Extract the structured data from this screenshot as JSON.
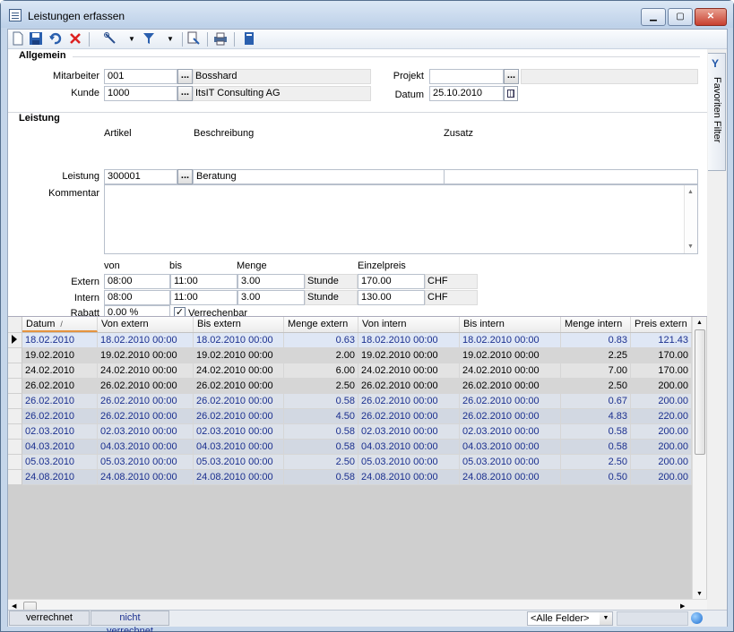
{
  "window": {
    "title": "Leistungen erfassen",
    "min_label": "▁",
    "max_label": "▢",
    "close_label": "✕"
  },
  "toolbar": {
    "icons": [
      "new-document-icon",
      "save-icon",
      "undo-icon",
      "delete-icon",
      "tools-icon",
      "filter-icon",
      "copy-record-icon",
      "print-icon",
      "book-icon"
    ]
  },
  "side_panel": {
    "label": "Favoriten Filter"
  },
  "allgemein": {
    "section_title": "Allgemein",
    "mitarbeiter_label": "Mitarbeiter",
    "mitarbeiter_value": "001",
    "mitarbeiter_name": "Bosshard",
    "kunde_label": "Kunde",
    "kunde_value": "1000",
    "kunde_name": "ItsIT Consulting AG",
    "projekt_label": "Projekt",
    "projekt_value": "",
    "datum_label": "Datum",
    "datum_value": "25.10.2010",
    "dots_label": "..."
  },
  "leistung": {
    "section_title": "Leistung",
    "col_artikel": "Artikel",
    "col_beschreibung": "Beschreibung",
    "col_zusatz": "Zusatz",
    "leistung_label": "Leistung",
    "artikel_value": "300001",
    "beschreibung_value": "Beratung",
    "zusatz_value": "",
    "kommentar_label": "Kommentar",
    "kommentar_value": "",
    "col_von": "von",
    "col_bis": "bis",
    "col_menge": "Menge",
    "col_einzelpreis": "Einzelpreis",
    "extern_label": "Extern",
    "extern_von": "08:00",
    "extern_bis": "11:00",
    "extern_menge": "3.00",
    "extern_einheit": "Stunde",
    "extern_preis": "170.00",
    "extern_waehrung": "CHF",
    "intern_label": "Intern",
    "intern_von": "08:00",
    "intern_bis": "11:00",
    "intern_menge": "3.00",
    "intern_einheit": "Stunde",
    "intern_preis": "130.00",
    "intern_waehrung": "CHF",
    "rabatt_label": "Rabatt",
    "rabatt_value": "0.00 %",
    "verrechenbar_label": "Verrechenbar",
    "verrechenbar_checked": true
  },
  "grid": {
    "columns": [
      "Datum",
      "Von extern",
      "Bis extern",
      "Menge extern",
      "Von intern",
      "Bis intern",
      "Menge intern",
      "Preis extern"
    ],
    "sort_indicator": "/",
    "rows": [
      [
        "18.02.2010",
        "18.02.2010  00:00",
        "18.02.2010  00:00",
        "0.63",
        "18.02.2010  00:00",
        "18.02.2010  00:00",
        "0.83",
        "121.43"
      ],
      [
        "19.02.2010",
        "19.02.2010  00:00",
        "19.02.2010  00:00",
        "2.00",
        "19.02.2010  00:00",
        "19.02.2010  00:00",
        "2.25",
        "170.00"
      ],
      [
        "24.02.2010",
        "24.02.2010  00:00",
        "24.02.2010  00:00",
        "6.00",
        "24.02.2010  00:00",
        "24.02.2010  00:00",
        "7.00",
        "170.00"
      ],
      [
        "26.02.2010",
        "26.02.2010  00:00",
        "26.02.2010  00:00",
        "2.50",
        "26.02.2010  00:00",
        "26.02.2010  00:00",
        "2.50",
        "200.00"
      ],
      [
        "26.02.2010",
        "26.02.2010  00:00",
        "26.02.2010  00:00",
        "0.58",
        "26.02.2010  00:00",
        "26.02.2010  00:00",
        "0.67",
        "200.00"
      ],
      [
        "26.02.2010",
        "26.02.2010  00:00",
        "26.02.2010  00:00",
        "4.50",
        "26.02.2010  00:00",
        "26.02.2010  00:00",
        "4.83",
        "220.00"
      ],
      [
        "02.03.2010",
        "02.03.2010  00:00",
        "02.03.2010  00:00",
        "0.58",
        "02.03.2010  00:00",
        "02.03.2010  00:00",
        "0.58",
        "200.00"
      ],
      [
        "04.03.2010",
        "04.03.2010  00:00",
        "04.03.2010  00:00",
        "0.58",
        "04.03.2010  00:00",
        "04.03.2010  00:00",
        "0.58",
        "200.00"
      ],
      [
        "05.03.2010",
        "05.03.2010  00:00",
        "05.03.2010  00:00",
        "2.50",
        "05.03.2010  00:00",
        "05.03.2010  00:00",
        "2.50",
        "200.00"
      ],
      [
        "24.08.2010",
        "24.08.2010  00:00",
        "24.08.2010  00:00",
        "0.58",
        "24.08.2010  00:00",
        "24.08.2010  00:00",
        "0.50",
        "200.00"
      ]
    ],
    "row_styles": [
      "sel",
      "plain",
      "plain",
      "plain",
      "blue",
      "blue",
      "blue",
      "blue",
      "blue",
      "blue"
    ]
  },
  "statusbar": {
    "tab_verrechnet": "verrechnet",
    "tab_nicht_verrechnet": "nicht verrechnet",
    "field_combo": "<Alle Felder>"
  },
  "colors": {
    "row_plain_a": "#e3e3e3",
    "row_plain_b": "#d6d6d6",
    "row_blue_a": "#dde2ea",
    "row_blue_b": "#d2d8e2",
    "row_sel": "#dfe7f5",
    "blue_text": "#1a2f8f"
  }
}
